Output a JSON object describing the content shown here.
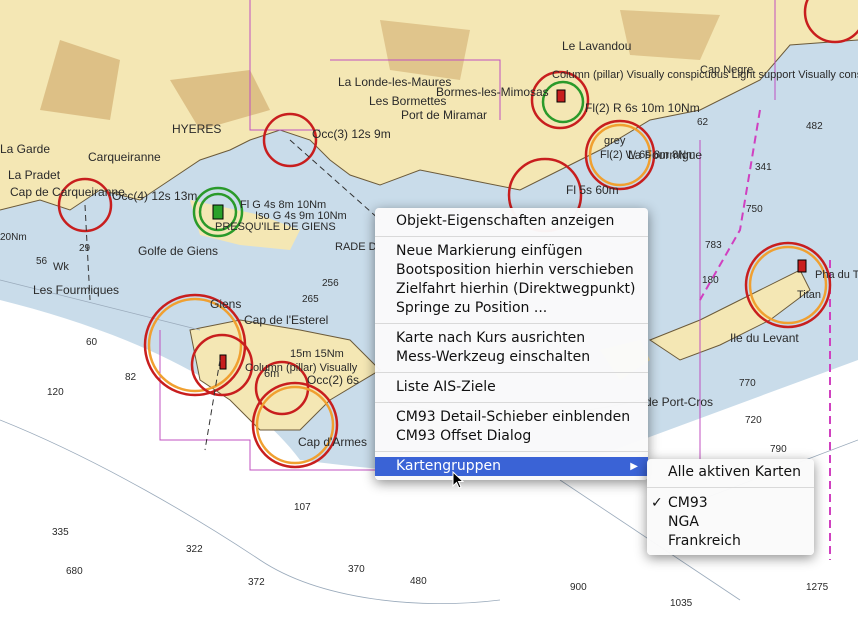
{
  "map": {
    "places": [
      "Le Lavandou",
      "Cap Negre",
      "Bormes-les-Mimosas",
      "La Londe-les-Maures",
      "Les Bormettes",
      "Port de Miramar",
      "HYERES",
      "La Garde",
      "Carqueiranne",
      "La Pradet",
      "Cap de Carqueiranne",
      "PRESQU'ILE DE GIENS",
      "Golfe de Giens",
      "Les Fourmiques",
      "Giens",
      "Cap de l'Esterel",
      "RADE D",
      "Cap d'Armes",
      "Ile du Levant",
      "La Fourmigue",
      "de Port-Cros",
      "Pha du T",
      "Titan"
    ],
    "light_labels": [
      "Occ(3) 12s 9m",
      "Occ(4) 12s 13m",
      "Fl G 4s 8m 10Nm",
      "Iso G 4s 9m 10Nm",
      "Fl(2) R 6s 10m 10Nm",
      "Fl(2) W 6s 8m 8Nm",
      "Fl 5s 60m",
      "Column (pillar) Visually conspicuous Light support Visually conspicuous",
      "Occ(2) 6s",
      "15m 15Nm",
      "Column (pillar) Visually",
      "grey",
      "6m",
      "Wk"
    ],
    "soundings": [
      "482",
      "62",
      "341",
      "750",
      "783",
      "180",
      "20Nm",
      "56",
      "60",
      "82",
      "120",
      "29",
      "256",
      "265",
      "107",
      "372",
      "322",
      "680",
      "335",
      "770",
      "370",
      "480",
      "900",
      "1035",
      "720",
      "790",
      "1275"
    ]
  },
  "context_menu": {
    "groups": [
      [
        "Objekt-Eigenschaften anzeigen"
      ],
      [
        "Neue Markierung einfügen",
        "Bootsposition hierhin verschieben",
        "Zielfahrt hierhin (Direktwegpunkt)",
        "Springe zu Position ..."
      ],
      [
        "Karte nach Kurs ausrichten",
        "Mess-Werkzeug einschalten"
      ],
      [
        "Liste AIS-Ziele"
      ],
      [
        "CM93 Detail-Schieber einblenden",
        "CM93 Offset Dialog"
      ]
    ],
    "submenu_parent": "Kartengruppen",
    "submenu_arrow": "▶"
  },
  "submenu": {
    "all_label": "Alle aktiven Karten",
    "checkmark": "✓",
    "items": [
      "CM93",
      "NGA",
      "Frankreich"
    ],
    "selected": "CM93"
  },
  "colors": {
    "land": "#f4e7b4",
    "sea_shallow": "#c9dcea",
    "sea_deep": "#ffffff",
    "highlight": "#3a63d6"
  }
}
